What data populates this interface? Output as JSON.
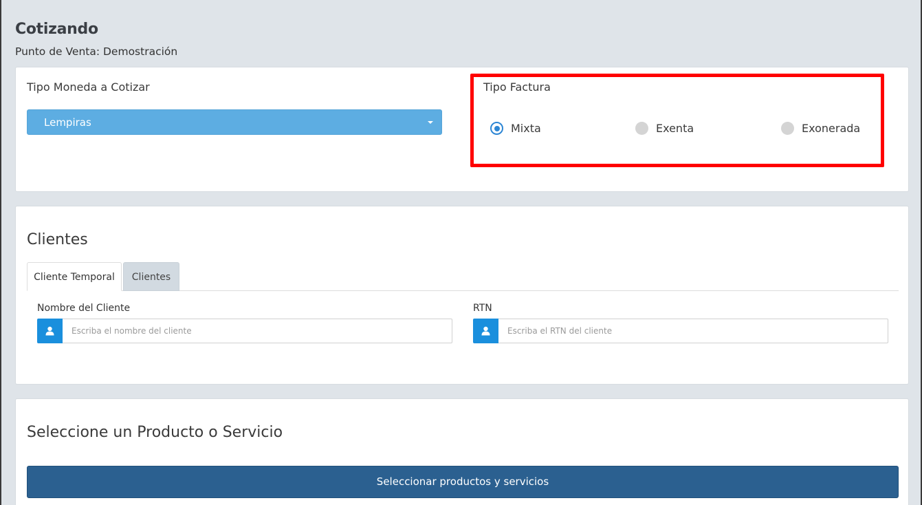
{
  "header": {
    "title": "Cotizando",
    "subtitle": "Punto de Venta: Demostración"
  },
  "moneda": {
    "label": "Tipo Moneda a Cotizar",
    "selected": "Lempiras"
  },
  "factura": {
    "label": "Tipo Factura",
    "options": [
      {
        "label": "Mixta",
        "checked": true
      },
      {
        "label": "Exenta",
        "checked": false
      },
      {
        "label": "Exonerada",
        "checked": false
      }
    ]
  },
  "clientes": {
    "title": "Clientes",
    "tabs": [
      {
        "label": "Cliente Temporal",
        "active": true
      },
      {
        "label": "Clientes",
        "active": false
      }
    ],
    "nombre": {
      "label": "Nombre del Cliente",
      "placeholder": "Escriba el nombre del cliente",
      "value": ""
    },
    "rtn": {
      "label": "RTN",
      "placeholder": "Escriba el RTN del cliente",
      "value": ""
    }
  },
  "productos": {
    "title": "Seleccione un Producto o Servicio",
    "button": "Seleccionar productos y servicios"
  },
  "colors": {
    "select_bg": "#5dade2",
    "radio_accent": "#2d86d4",
    "addon_bg": "#1a8fdd",
    "primary_button": "#2b6090",
    "highlight": "#ff0000"
  },
  "icons": {
    "select_caret": "caret-down-icon",
    "input_addon": "user-icon"
  }
}
